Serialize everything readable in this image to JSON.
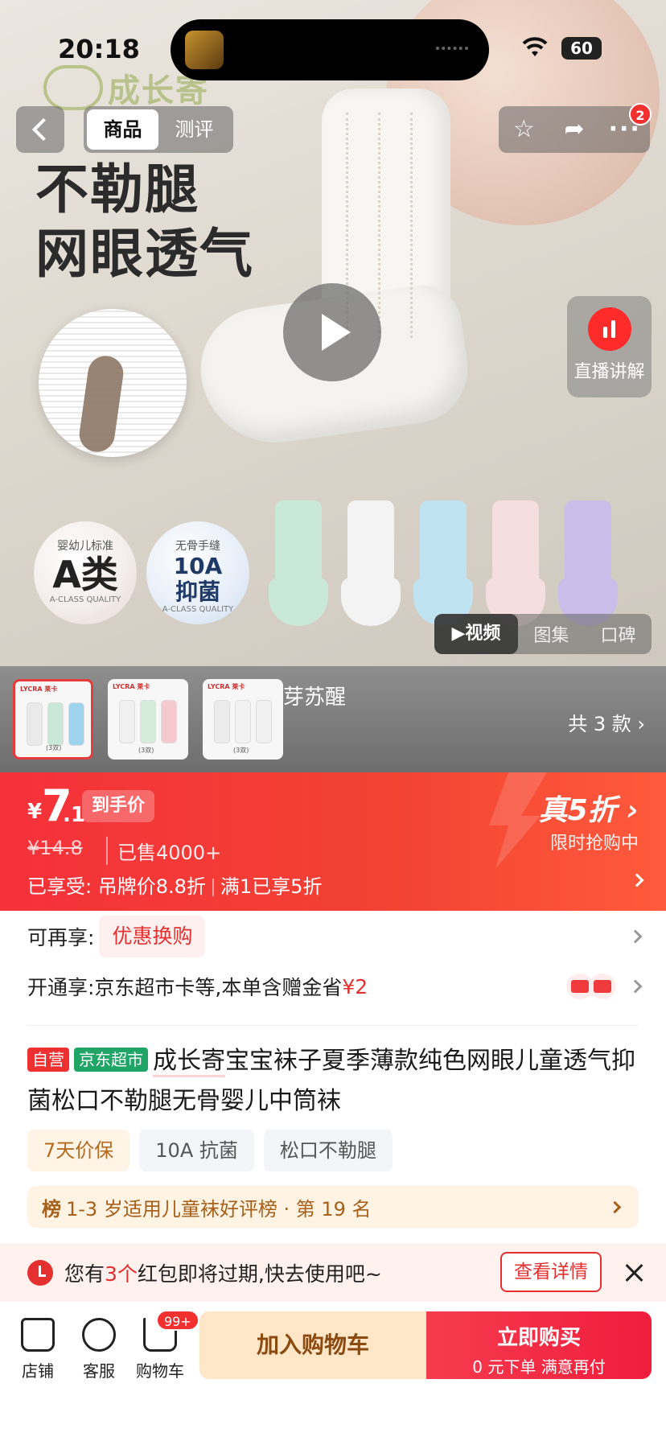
{
  "status_bar": {
    "time": "20:18",
    "battery": "60"
  },
  "nav": {
    "tabs": [
      {
        "label": "商品",
        "active": true
      },
      {
        "label": "测评",
        "active": false
      }
    ],
    "notification_count": "2"
  },
  "hero": {
    "logo_text": "成长寄",
    "headline": [
      "不勒腿",
      "网眼透气"
    ],
    "badge_a": {
      "top": "婴幼儿标准",
      "big": "A类",
      "bottom": "A-CLASS QUALITY"
    },
    "badge_b": {
      "top": "无骨手缝",
      "big": "10A",
      "big2": "抑菌",
      "bottom": "A-CLASS QUALITY"
    },
    "sock_colors": [
      "#c9e8d8",
      "#f3f3f3",
      "#bfe3f0",
      "#f5dde0",
      "#cbbce9"
    ],
    "live_label": "直播讲解",
    "media_tabs": [
      {
        "label": "▶视频",
        "active": true
      },
      {
        "label": "图集",
        "active": false
      },
      {
        "label": "口碑",
        "active": false
      }
    ]
  },
  "variants": {
    "name": "芽苏醒",
    "count": "共 3 款",
    "thumbs": [
      {
        "label": "LYCRA 莱卡",
        "qty": "(3双)",
        "colors": [
          "#eaeaea",
          "#c9e8d8",
          "#9fd3ec"
        ],
        "selected": true
      },
      {
        "label": "LYCRA 莱卡",
        "qty": "(3双)",
        "colors": [
          "#f0f0f0",
          "#d4ecd9",
          "#f6c9cf"
        ],
        "selected": false
      },
      {
        "label": "LYCRA 莱卡",
        "qty": "(3双)",
        "colors": [
          "#ececec",
          "#f2f2f2",
          "#f0f0f0"
        ],
        "selected": false
      }
    ]
  },
  "price": {
    "currency": "¥",
    "integer": "7",
    "decimal": ".1",
    "tag": "到手价",
    "original": "¥14.8",
    "sold": "已售4000+",
    "enjoyed_label": "已享受:",
    "enjoyed_1": "吊牌价8.8折",
    "enjoyed_2": "满1已享5折",
    "discount": "真5折",
    "flash": "限时抢购中"
  },
  "offers": {
    "more_label": "可再享:",
    "more_pill": "优惠换购",
    "open_label": "开通享:京东超市卡等,本单含赠金省",
    "open_amount": "¥2"
  },
  "product": {
    "tag_self": "自营",
    "tag_jd": "京东超市",
    "brand": "成长寄",
    "title_rest": "宝宝袜子夏季薄款纯色网眼儿童透气抑菌松口不勒腿无骨婴儿中筒袜",
    "chips": [
      "7天价保",
      "10A 抗菌",
      "松口不勒腿"
    ],
    "rank_label": "榜",
    "rank_text": "1-3 岁适用儿童袜好评榜 · 第 19 名"
  },
  "notice": {
    "pre": "您有",
    "count": "3个",
    "post": "红包即将过期,快去使用吧~",
    "button": "查看详情"
  },
  "bottom_bar": {
    "store": "店铺",
    "service": "客服",
    "cart": "购物车",
    "cart_badge": "99+",
    "add_cart": "加入购物车",
    "buy_main": "立即购买",
    "buy_sub": "0 元下单 满意再付"
  }
}
